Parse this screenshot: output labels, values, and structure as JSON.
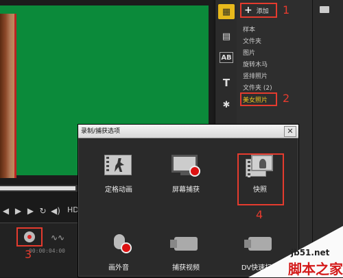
{
  "library": {
    "add_label": "添加",
    "items": [
      "样本",
      "文件夹",
      "图片",
      "旋转木马",
      "竖排照片",
      "文件夹 (2)"
    ],
    "selected": "美女照片"
  },
  "markers": {
    "m1": "1",
    "m2": "2",
    "m3": "3",
    "m4": "4"
  },
  "transport": {
    "hd": "HD"
  },
  "timeline": {
    "timecode": "00:00:04:00"
  },
  "dialog": {
    "title": "录制/捕获选项",
    "close": "✕",
    "options": [
      "定格动画",
      "屏幕捕获",
      "快照",
      "画外音",
      "捕获视频",
      "DV快速扫描"
    ]
  },
  "watermark": {
    "site": "jb51.net",
    "name": "脚本之家"
  },
  "colors": {
    "highlight": "#e63b2e",
    "preview_bg": "#0b8a3a",
    "selected_text": "#f0c41c"
  }
}
